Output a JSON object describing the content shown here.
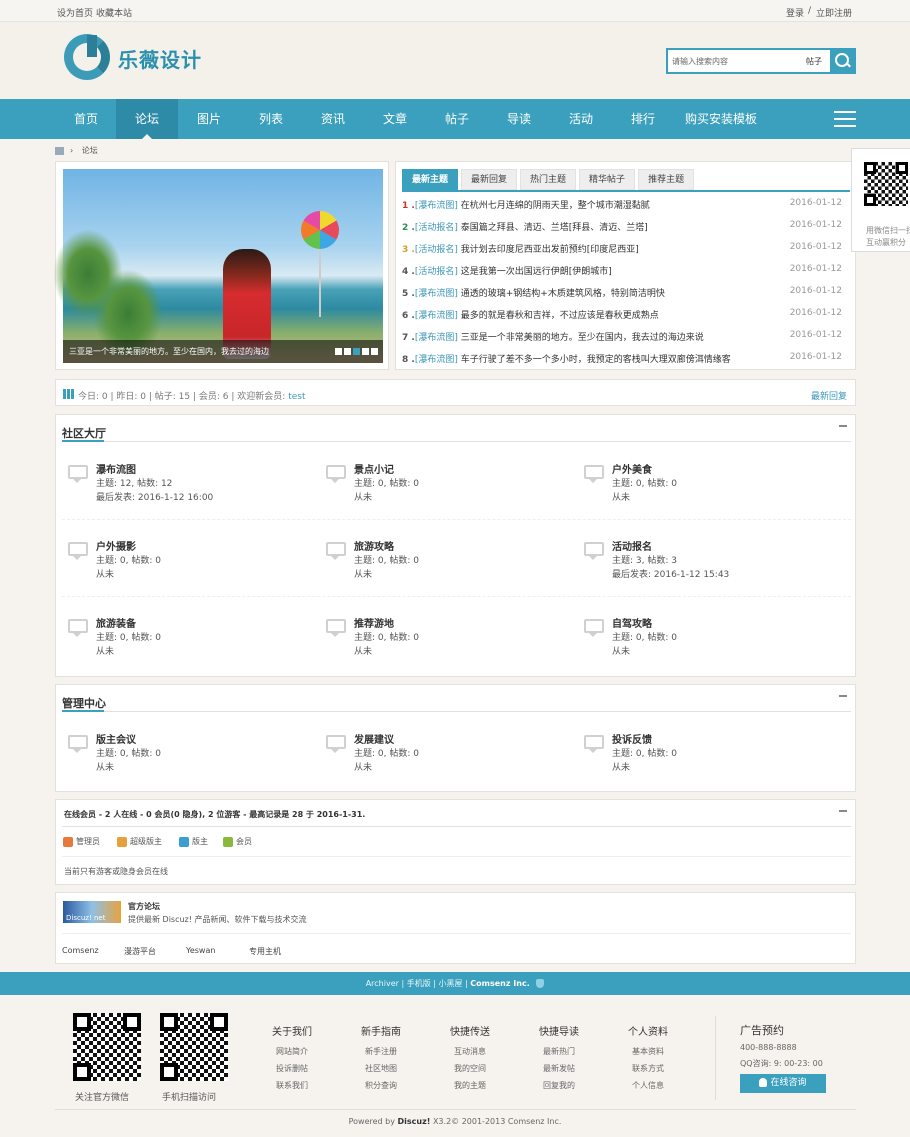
{
  "topbar": {
    "set_home": "设为首页",
    "bookmark": "收藏本站",
    "login": "登录",
    "sep": "/",
    "register": "立即注册"
  },
  "brand": {
    "logo_text": "乐薇设计",
    "accent": "#3ba0bd"
  },
  "search": {
    "placeholder": "请输入搜索内容",
    "type": "帖子"
  },
  "nav": [
    "首页",
    "论坛",
    "图片",
    "列表",
    "资讯",
    "文章",
    "帖子",
    "导读",
    "活动",
    "排行",
    "购买安装模板"
  ],
  "nav_active": "论坛",
  "breadcrumb": {
    "current": "论坛"
  },
  "slide": {
    "caption": "三亚是一个非常美丽的地方。至少在国内，我去过的海边"
  },
  "topics": {
    "tabs": [
      "最新主题",
      "最新回复",
      "热门主题",
      "精华帖子",
      "推荐主题"
    ],
    "rows": [
      {
        "n": "1 .",
        "cat": "[瀑布流图]",
        "title": "在杭州七月连绵的阴雨天里，整个城市潮湿黏腻",
        "date": "2016-01-12"
      },
      {
        "n": "2 .",
        "cat": "[活动报名]",
        "title": "泰国篇之拜县、清迈、兰塔[拜县、清迈、兰塔]",
        "date": "2016-01-12"
      },
      {
        "n": "3 .",
        "cat": "[活动报名]",
        "title": "我计划去印度尼西亚出发前预约[印度尼西亚]",
        "date": "2016-01-12"
      },
      {
        "n": "4 .",
        "cat": "[活动报名]",
        "title": "这是我第一次出国远行伊朗[伊朗城市]",
        "date": "2016-01-12"
      },
      {
        "n": "5 .",
        "cat": "[瀑布流图]",
        "title": "通透的玻璃+钢结构+木质建筑风格，特别简洁明快",
        "date": "2016-01-12"
      },
      {
        "n": "6 .",
        "cat": "[瀑布流图]",
        "title": "最多的就是春秋和吉祥，不过应该是春秋更成熟点",
        "date": "2016-01-12"
      },
      {
        "n": "7 .",
        "cat": "[瀑布流图]",
        "title": "三亚是一个非常美丽的地方。至少在国内，我去过的海边来说",
        "date": "2016-01-12"
      },
      {
        "n": "8 .",
        "cat": "[瀑布流图]",
        "title": "车子行驶了差不多一个多小时，我预定的客栈叫大理双廊傍洱情缘客",
        "date": "2016-01-12"
      }
    ]
  },
  "side_qr": {
    "close": "x",
    "line1": "用微信扫一扫",
    "line2": "互动赢积分"
  },
  "stats": {
    "today": "今日: 0",
    "yesterday": "昨日: 0",
    "posts": "帖子: 15",
    "members": "会员: 6",
    "welcome": "欢迎新会员:",
    "newest": "test",
    "latest_reply": "最新回复"
  },
  "community": {
    "title": "社区大厅",
    "forums": [
      {
        "name": "瀑布流图",
        "count": "主题: 12, 帖数: 12",
        "last": "最后发表: 2016-1-12 16:00"
      },
      {
        "name": "景点小记",
        "count": "主题: 0, 帖数: 0",
        "last": "从未"
      },
      {
        "name": "户外美食",
        "count": "主题: 0, 帖数: 0",
        "last": "从未"
      },
      {
        "name": "户外摄影",
        "count": "主题: 0, 帖数: 0",
        "last": "从未"
      },
      {
        "name": "旅游攻略",
        "count": "主题: 0, 帖数: 0",
        "last": "从未"
      },
      {
        "name": "活动报名",
        "count": "主题: 3, 帖数: 3",
        "last": "最后发表: 2016-1-12 15:43"
      },
      {
        "name": "旅游装备",
        "count": "主题: 0, 帖数: 0",
        "last": "从未"
      },
      {
        "name": "推荐游地",
        "count": "主题: 0, 帖数: 0",
        "last": "从未"
      },
      {
        "name": "自驾攻略",
        "count": "主题: 0, 帖数: 0",
        "last": "从未"
      }
    ]
  },
  "admin": {
    "title": "管理中心",
    "forums": [
      {
        "name": "版主会议",
        "count": "主题: 0, 帖数: 0",
        "last": "从未"
      },
      {
        "name": "发展建议",
        "count": "主题: 0, 帖数: 0",
        "last": "从未"
      },
      {
        "name": "投诉反馈",
        "count": "主题: 0, 帖数: 0",
        "last": "从未"
      }
    ]
  },
  "online": {
    "header": "在线会员 - 2 人在线 - 0 会员(0 隐身), 2 位游客 - 最高记录是 28 于 2016-1-31.",
    "legend": [
      {
        "label": "管理员",
        "color": "#e8793a"
      },
      {
        "label": "超级版主",
        "color": "#e5a03a"
      },
      {
        "label": "版主",
        "color": "#3b9fd1"
      },
      {
        "label": "会员",
        "color": "#8ab83a"
      }
    ],
    "none": "当前只有游客或隐身会员在线"
  },
  "links": {
    "banner": "Discuz! net",
    "title": "官方论坛",
    "desc": "提供最新 Discuz! 产品新闻、软件下载与技术交流",
    "friends": [
      "Comsenz",
      "漫游平台",
      "Yeswan",
      "专用主机"
    ]
  },
  "footbar": {
    "archiver": "Archiver",
    "mobile": "手机版",
    "dark": "小黑屋",
    "company": "Comsenz Inc."
  },
  "footer": {
    "qr1": "关注官方微信",
    "qr2": "手机扫描访问",
    "cols": [
      {
        "h": "关于我们",
        "items": [
          "网站简介",
          "投诉删帖",
          "联系我们"
        ]
      },
      {
        "h": "新手指南",
        "items": [
          "新手注册",
          "社区地图",
          "积分查询"
        ]
      },
      {
        "h": "快捷传送",
        "items": [
          "互动消息",
          "我的空间",
          "我的主题"
        ]
      },
      {
        "h": "快捷导读",
        "items": [
          "最新热门",
          "最新发帖",
          "回复我的"
        ]
      },
      {
        "h": "个人资料",
        "items": [
          "基本资料",
          "联系方式",
          "个人信息"
        ]
      }
    ],
    "ad_title": "广告预约",
    "phone": "400-888-8888",
    "qq": "QQ咨询: 9: 00-23: 00",
    "online_btn": "在线咨询",
    "powered": "Powered by",
    "discuz": "Discuz!",
    "copyright": "X3.2© 2001-2013 Comsenz Inc."
  }
}
